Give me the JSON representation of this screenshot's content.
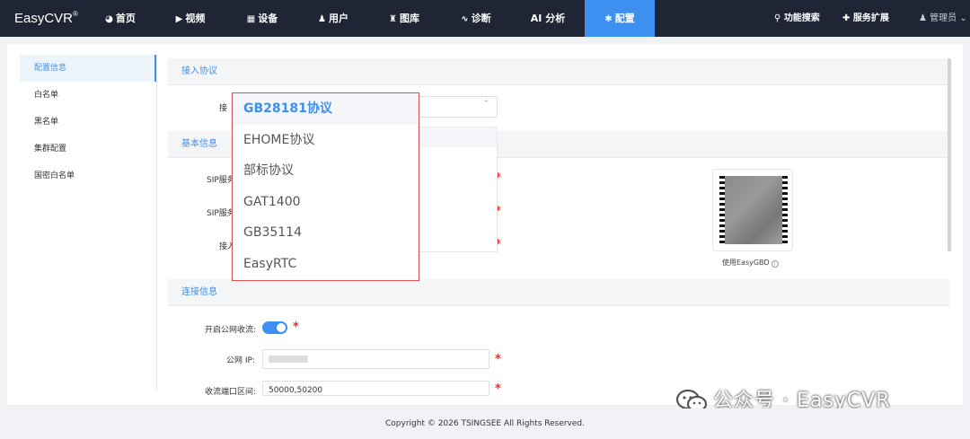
{
  "app": {
    "logo_text": "EasyCVR",
    "logo_reg": "®"
  },
  "nav": {
    "items": [
      {
        "icon": "dashboard-icon",
        "glyph": "◕",
        "label": "首页"
      },
      {
        "icon": "play-icon",
        "glyph": "▶",
        "label": "视频"
      },
      {
        "icon": "device-icon",
        "glyph": "▦",
        "label": "设备"
      },
      {
        "icon": "user-icon",
        "glyph": "♟",
        "label": "用户"
      },
      {
        "icon": "gallery-icon",
        "glyph": "♜",
        "label": "图库"
      },
      {
        "icon": "pulse-icon",
        "glyph": "∿",
        "label": "诊断"
      },
      {
        "icon": "",
        "glyph": "",
        "label": "AI 分析"
      },
      {
        "icon": "gear-icon",
        "glyph": "✱",
        "label": "配置"
      }
    ],
    "right": [
      {
        "icon": "search-icon",
        "glyph": "⚲",
        "label": "功能搜索"
      },
      {
        "icon": "puzzle-icon",
        "glyph": "✚",
        "label": "服务扩展"
      }
    ],
    "user": {
      "glyph": "♟",
      "label": "管理员",
      "caret": "⌄"
    }
  },
  "sidebar": {
    "items": [
      {
        "label": "配置信息",
        "active": true
      },
      {
        "label": "白名单"
      },
      {
        "label": "黑名单"
      },
      {
        "label": "集群配置"
      },
      {
        "label": "国密白名单"
      }
    ]
  },
  "sections": {
    "protocol": "接入协议",
    "basic": "基本信息",
    "connect": "连接信息"
  },
  "form": {
    "protocol_label_partial": "接",
    "sip_label_1_partial": "SIP服务",
    "sip_label_2_partial": "SIP服务",
    "access_label_partial": "接入",
    "public_stream_label": "开启公网收流:",
    "public_ip_label": "公网 IP:",
    "port_range_label": "收流端口区间:",
    "port_range_value": "50000,50200",
    "required_mark": "*",
    "select_arrow": "⌃"
  },
  "dropdown": {
    "options": [
      "GB28181协议",
      "EHOME协议",
      "部标协议",
      "GAT1400",
      "GB35114",
      "EasyRTC"
    ],
    "selected_index": 0
  },
  "qr": {
    "caption": "使用EasyGBD",
    "info_glyph": "i"
  },
  "watermark": {
    "text": "公众号 · EasyCVR"
  },
  "footer": {
    "copyright": "Copyright © 2026 TSINGSEE All Rights Reserved."
  },
  "colors": {
    "topbar": "#1f2535",
    "accent": "#3d8ff0",
    "required": "#e23232",
    "dropdown_border": "#dd5050"
  }
}
